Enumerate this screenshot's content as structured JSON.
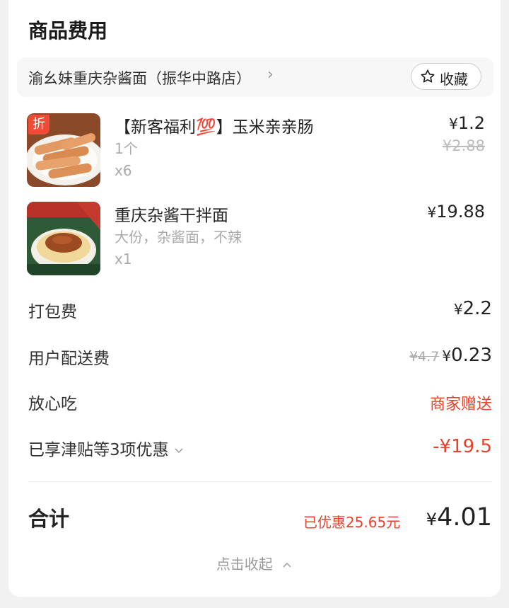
{
  "section_title": "商品费用",
  "shop": {
    "name": "渝幺妹重庆杂酱面（振华中路店）",
    "chevron": "›",
    "favorite_label": "收藏"
  },
  "items": [
    {
      "badge": "折",
      "name": "【新客福利💯】玉米亲亲肠",
      "spec": "1个",
      "qty": "x6",
      "price": "1.2",
      "original_price": "¥2.88"
    },
    {
      "name": "重庆杂酱干拌面",
      "spec": "大份，杂酱面，不辣",
      "qty": "x1",
      "price": "19.88"
    }
  ],
  "fees": {
    "packing": {
      "label": "打包费",
      "amount": "2.2"
    },
    "delivery": {
      "label": "用户配送费",
      "original": "¥4.7",
      "amount": "0.23"
    },
    "safe_eat": {
      "label": "放心吃",
      "value": "商家赠送"
    },
    "discount": {
      "label": "已享津贴等3项优惠",
      "amount": "-¥19.5"
    }
  },
  "summary": {
    "label": "合计",
    "saved": "已优惠25.65元",
    "total": "4.01",
    "collapse_label": "点击收起"
  },
  "currency": "¥",
  "colors": {
    "accent_red": "#e8412c",
    "badge_red": "#f04b36"
  }
}
